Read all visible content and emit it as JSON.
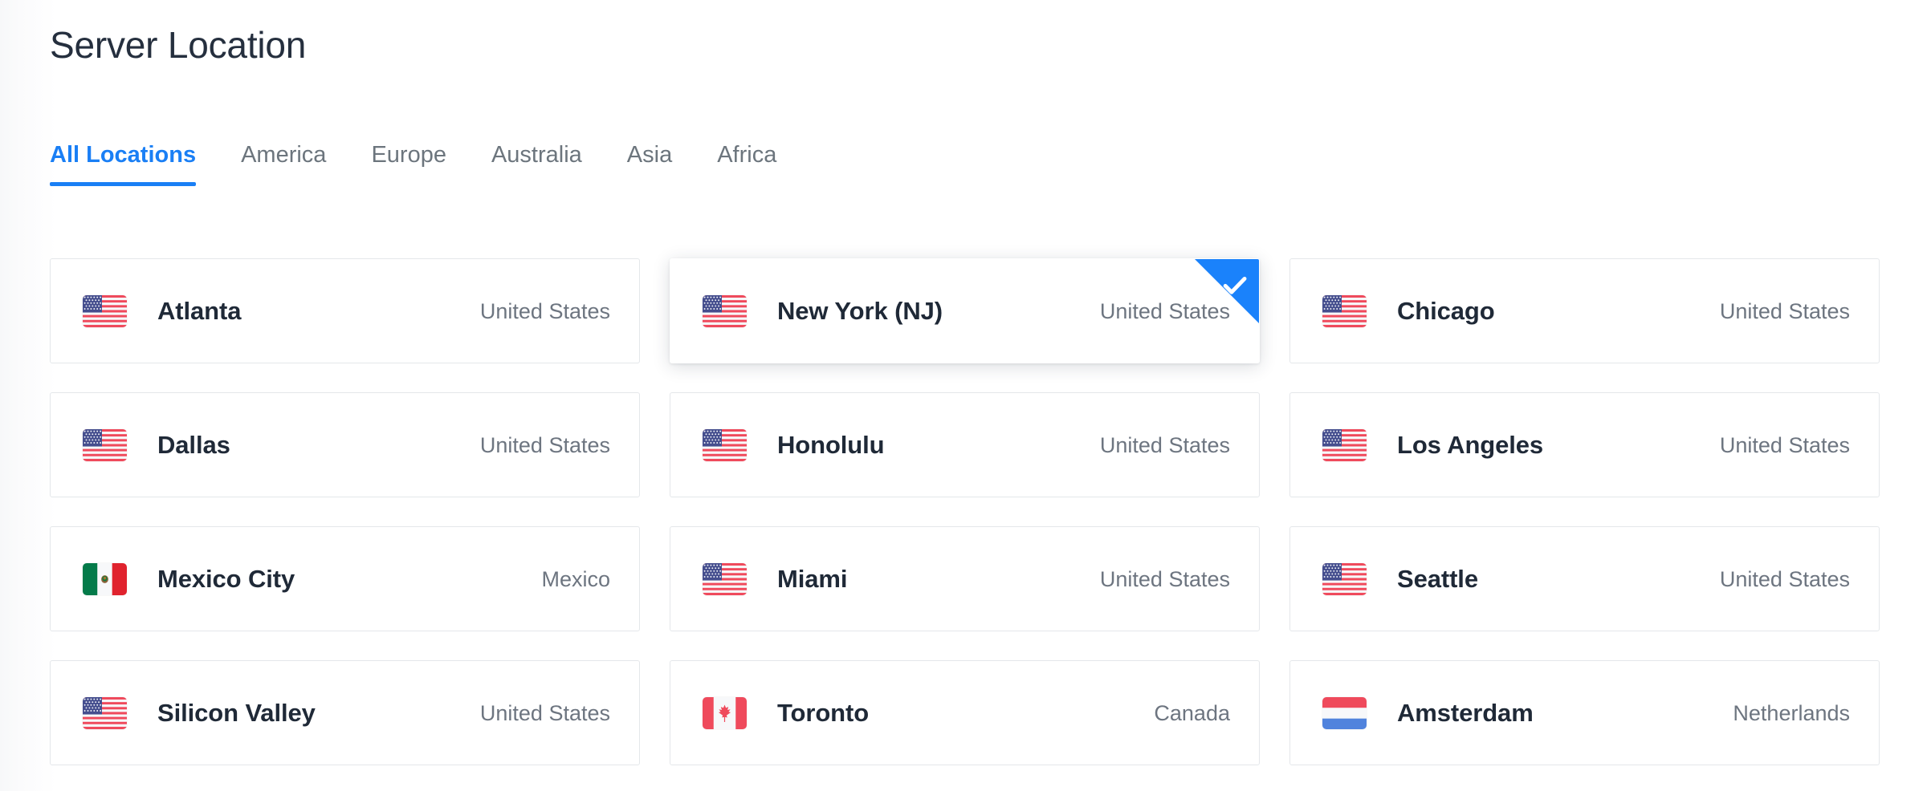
{
  "header": {
    "title": "Server Location"
  },
  "tabs": {
    "active_index": 0,
    "items": [
      {
        "label": "All Locations"
      },
      {
        "label": "America"
      },
      {
        "label": "Europe"
      },
      {
        "label": "Australia"
      },
      {
        "label": "Asia"
      },
      {
        "label": "Africa"
      }
    ]
  },
  "colors": {
    "accent": "#1a7ff5",
    "badge": "#1a82fb",
    "title": "#252f3e",
    "city": "#1f2937",
    "country": "#6d7580",
    "tab_inactive": "#6c757d",
    "card_border": "#e4e7ea"
  },
  "locations": [
    {
      "city": "Atlanta",
      "country": "United States",
      "flag": "flag-us",
      "selected": false
    },
    {
      "city": "New York (NJ)",
      "country": "United States",
      "flag": "flag-us",
      "selected": true
    },
    {
      "city": "Chicago",
      "country": "United States",
      "flag": "flag-us",
      "selected": false
    },
    {
      "city": "Dallas",
      "country": "United States",
      "flag": "flag-us",
      "selected": false
    },
    {
      "city": "Honolulu",
      "country": "United States",
      "flag": "flag-us",
      "selected": false
    },
    {
      "city": "Los Angeles",
      "country": "United States",
      "flag": "flag-us",
      "selected": false
    },
    {
      "city": "Mexico City",
      "country": "Mexico",
      "flag": "flag-mx",
      "selected": false
    },
    {
      "city": "Miami",
      "country": "United States",
      "flag": "flag-us",
      "selected": false
    },
    {
      "city": "Seattle",
      "country": "United States",
      "flag": "flag-us",
      "selected": false
    },
    {
      "city": "Silicon Valley",
      "country": "United States",
      "flag": "flag-us",
      "selected": false
    },
    {
      "city": "Toronto",
      "country": "Canada",
      "flag": "flag-ca",
      "selected": false
    },
    {
      "city": "Amsterdam",
      "country": "Netherlands",
      "flag": "flag-nl",
      "selected": false
    }
  ],
  "icons": {
    "check": "check-icon"
  }
}
